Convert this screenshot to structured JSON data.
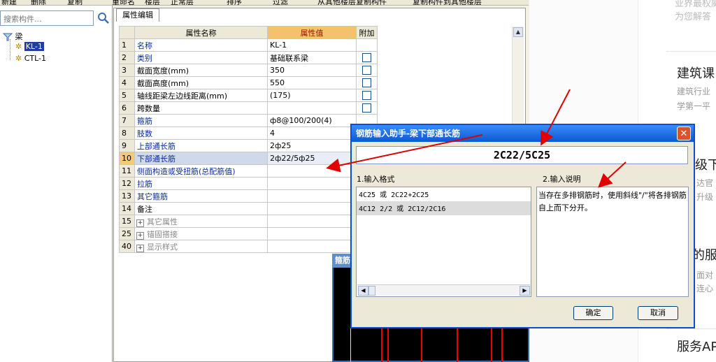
{
  "toolbar": {
    "items": [
      "新建",
      "删除",
      "复制",
      "重命名",
      "楼层",
      "正常层",
      "排序",
      "过滤",
      "从其他楼层复制构件",
      "复制构件到其他楼层"
    ]
  },
  "tree": {
    "search_placeholder": "搜索构件...",
    "root": "梁",
    "items": [
      "KL-1",
      "CTL-1"
    ]
  },
  "props": {
    "tab": "属性编辑",
    "columns": [
      "属性名称",
      "属性值",
      "附加"
    ],
    "rows": [
      {
        "num": "1",
        "name": "名称",
        "value": "KL-1"
      },
      {
        "num": "2",
        "name": "类别",
        "value": "基础联系梁"
      },
      {
        "num": "3",
        "name": "截面宽度(mm)",
        "value": "350"
      },
      {
        "num": "4",
        "name": "截面高度(mm)",
        "value": "550"
      },
      {
        "num": "5",
        "name": "轴线距梁左边线距离(mm)",
        "value": "(175)"
      },
      {
        "num": "6",
        "name": "跨数量",
        "value": ""
      },
      {
        "num": "7",
        "name": "箍筋",
        "value": "ф8@100/200(4)"
      },
      {
        "num": "8",
        "name": "肢数",
        "value": "4"
      },
      {
        "num": "9",
        "name": "上部通长筋",
        "value": "2ф25"
      },
      {
        "num": "10",
        "name": "下部通长筋",
        "value": "2ф22/5ф25"
      },
      {
        "num": "11",
        "name": "侧面构造或受扭筋(总配筋值)",
        "value": ""
      },
      {
        "num": "12",
        "name": "拉筋",
        "value": ""
      },
      {
        "num": "13",
        "name": "其它箍筋",
        "value": ""
      },
      {
        "num": "14",
        "name": "备注",
        "value": ""
      },
      {
        "num": "15",
        "name": "其它属性",
        "value": ""
      },
      {
        "num": "25",
        "name": "锚固搭接",
        "value": ""
      },
      {
        "num": "40",
        "name": "显示样式",
        "value": ""
      }
    ]
  },
  "black_window": {
    "title": "箍筋"
  },
  "dialog": {
    "title": "钢筋输入助手-梁下部通长筋",
    "input_value": "2C22/5C25",
    "format_label": "1.输入格式",
    "desc_label": "2.输入说明",
    "formats": [
      "4C25 或 2C22+2C25",
      "4C12 2/2 或 2C12/2C16"
    ],
    "description": "当存在多排钢筋时，使用斜线\"/\"将各排钢筋自上而下分开。",
    "ok": "确定",
    "cancel": "取消"
  },
  "webpage": {
    "top_lines": [
      "业界最权威",
      "为您解答"
    ],
    "block1_title": "建筑课",
    "block1_lines": [
      "建筑行业",
      "学第一平"
    ],
    "block2_title": "级下",
    "block2_lines": [
      "达官",
      "升级"
    ],
    "block3_title": "的服",
    "block3_lines": [
      "面对",
      "连心"
    ],
    "block4_title": "服务AP"
  },
  "colors": {
    "title_bar": "#0a58d6",
    "arrow": "#e00000",
    "selected_row": "#cfd9ea"
  }
}
